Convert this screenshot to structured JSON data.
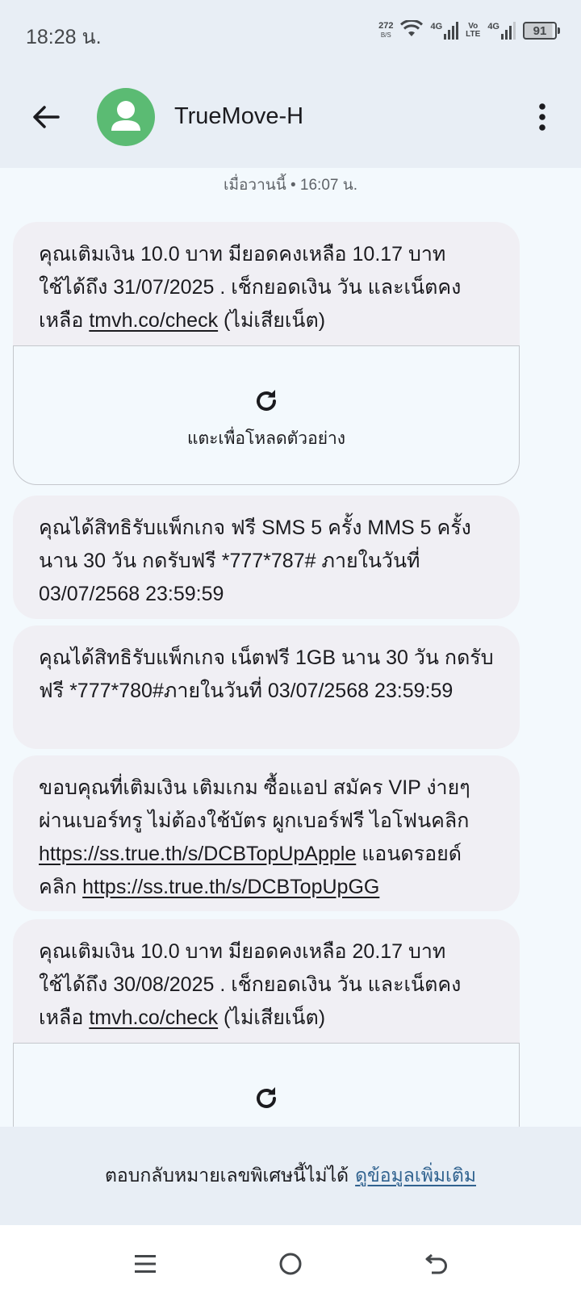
{
  "status_bar": {
    "time": "18:28 น.",
    "net_speed_value": "272",
    "net_speed_unit": "B/S",
    "sim1_type": "4G",
    "volte_top": "Vo",
    "volte_bottom": "LTE",
    "sim2_type": "4G",
    "battery": "91"
  },
  "header": {
    "contact_name": "TrueMove-H",
    "icons": [
      "back-arrow-icon",
      "person-icon",
      "more-vert-icon"
    ],
    "avatar_color": "#5bbb73"
  },
  "thread": {
    "timestamp": "เมื่อวานนี้ • 16:07 น.",
    "messages": [
      {
        "text_before": "คุณเติมเงิน 10.0 บาท มียอดคงเหลือ 10.17 บาท ใช้ได้ถึง 31/07/2025 . เช็กยอดเงิน วัน และเน็ตคงเหลือ ",
        "link": "tmvh.co/check",
        "text_after": " (ไม่เสียเน็ต)",
        "preview_label": "แตะเพื่อโหลดตัวอย่าง"
      },
      {
        "text": "คุณได้สิทธิรับแพ็กเกจ ฟรี SMS 5 ครั้ง MMS 5 ครั้ง นาน 30 วัน กดรับฟรี *777*787# ภายในวันที่ 03/07/2568 23:59:59"
      },
      {
        "text": "คุณได้สิทธิรับแพ็กเกจ เน็ตฟรี 1GB นาน 30 วัน กดรับฟรี *777*780#ภายในวันที่ 03/07/2568 23:59:59"
      },
      {
        "text_before": "ขอบคุณที่เติมเงิน เติมเกม ซื้อแอป สมัคร VIP ง่ายๆ ผ่านเบอร์ทรู ไม่ต้องใช้บัตร ผูกเบอร์ฟรี ไอโฟนคลิก ",
        "link1": "https://ss.true.th/s/DCBTopUpApple",
        "text_middle": " แอนดรอยด์คลิก ",
        "link2": "https://ss.true.th/s/DCBTopUpGG"
      },
      {
        "text_before": "คุณเติมเงิน 10.0 บาท มียอดคงเหลือ 20.17 บาท ใช้ได้ถึง 30/08/2025 . เช็กยอดเงิน วัน และเน็ตคงเหลือ ",
        "link": "tmvh.co/check",
        "text_after": " (ไม่เสียเน็ต)"
      }
    ]
  },
  "footer": {
    "notice": "ตอบกลับหมายเลขพิเศษนี้ไม่ได้",
    "link": "ดูข้อมูลเพิ่มเติม",
    "link_color": "#30628f"
  },
  "nav": {
    "icons": [
      "recent-apps-icon",
      "home-icon",
      "back-icon"
    ]
  }
}
